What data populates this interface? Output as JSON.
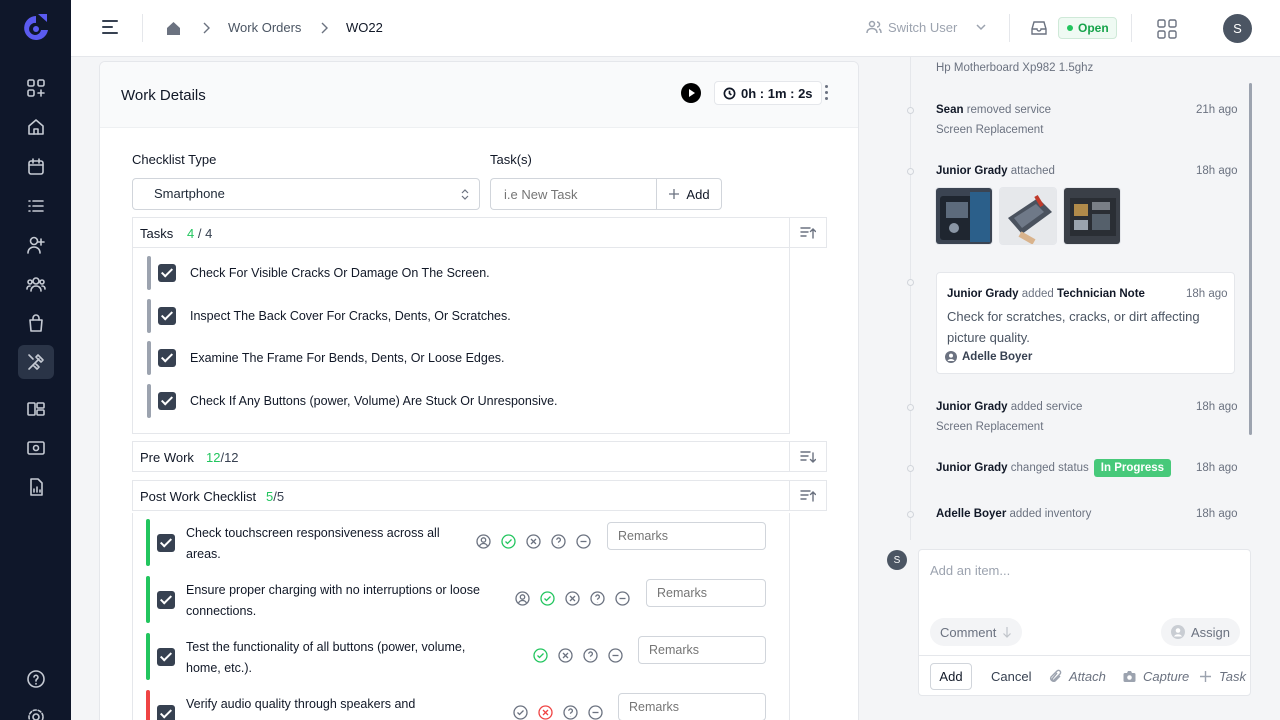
{
  "header": {
    "breadcrumbs": [
      "Work Orders",
      "WO22"
    ],
    "switch_user": "Switch User",
    "status": "Open",
    "avatar_initial": "S"
  },
  "work_details": {
    "title": "Work Details",
    "timer": "0h : 1m : 2s",
    "checklist_type_label": "Checklist Type",
    "checklist_type_value": "Smartphone",
    "tasks_label": "Task(s)",
    "task_placeholder": "i.e New Task",
    "add_label": "Add"
  },
  "tasks": {
    "title": "Tasks",
    "done": "4",
    "total": " / 4",
    "items": [
      "Check For Visible Cracks Or Damage On The Screen.",
      "Inspect The Back Cover For Cracks, Dents, Or Scratches.",
      "Examine The Frame For Bends, Dents, Or Loose Edges.",
      "Check If Any Buttons (power, Volume) Are Stuck Or Unresponsive."
    ]
  },
  "pre_work": {
    "title": "Pre Work",
    "done": "12",
    "total": "/12"
  },
  "post_work": {
    "title": "Post Work Checklist",
    "done": "5",
    "total": "/5",
    "remarks_placeholder": "Remarks",
    "items": [
      {
        "line1": "Check touchscreen responsiveness across all",
        "line2": "areas.",
        "selected": "pass"
      },
      {
        "line1": "Ensure proper charging with no interruptions or loose",
        "line2": "connections.",
        "selected": "pass"
      },
      {
        "line1": "Test the functionality of all buttons (power, volume,",
        "line2": "home, etc.).",
        "selected": "pass"
      },
      {
        "line1": "Verify audio quality through speakers and",
        "line2": "",
        "selected": "fail"
      }
    ]
  },
  "activity": {
    "top_sub": "Hp Motherboard Xp982 1.5ghz",
    "e1_user": "Sean",
    "e1_action": "removed service",
    "e1_sub": "Screen Replacement",
    "e1_ago": "21h ago",
    "e2_user": "Junior Grady",
    "e2_action": "attached",
    "e2_ago": "18h ago",
    "note_user": "Junior Grady",
    "note_action": "added",
    "note_type": "Technician Note",
    "note_ago": "18h ago",
    "note_body": "Check for scratches, cracks, or dirt affecting picture quality.",
    "note_assignee": "Adelle Boyer",
    "e4_user": "Junior Grady",
    "e4_action": "added service",
    "e4_sub": "Screen Replacement",
    "e4_ago": "18h ago",
    "e5_user": "Junior Grady",
    "e5_action": "changed status",
    "e5_badge": "In Progress",
    "e5_ago": "18h ago",
    "e6_user": "Adelle Boyer",
    "e6_action": "added inventory",
    "e6_ago": "18h ago"
  },
  "comment": {
    "avatar_initial": "S",
    "placeholder": "Add an item...",
    "comment_label": "Comment",
    "assign_label": "Assign",
    "add": "Add",
    "cancel": "Cancel",
    "attach": "Attach",
    "capture": "Capture",
    "task": "Task"
  },
  "colors": {
    "sidebar": "#0f172a",
    "accent": "#22c55e",
    "fail": "#ef4444",
    "logo": "#4f46e5"
  }
}
